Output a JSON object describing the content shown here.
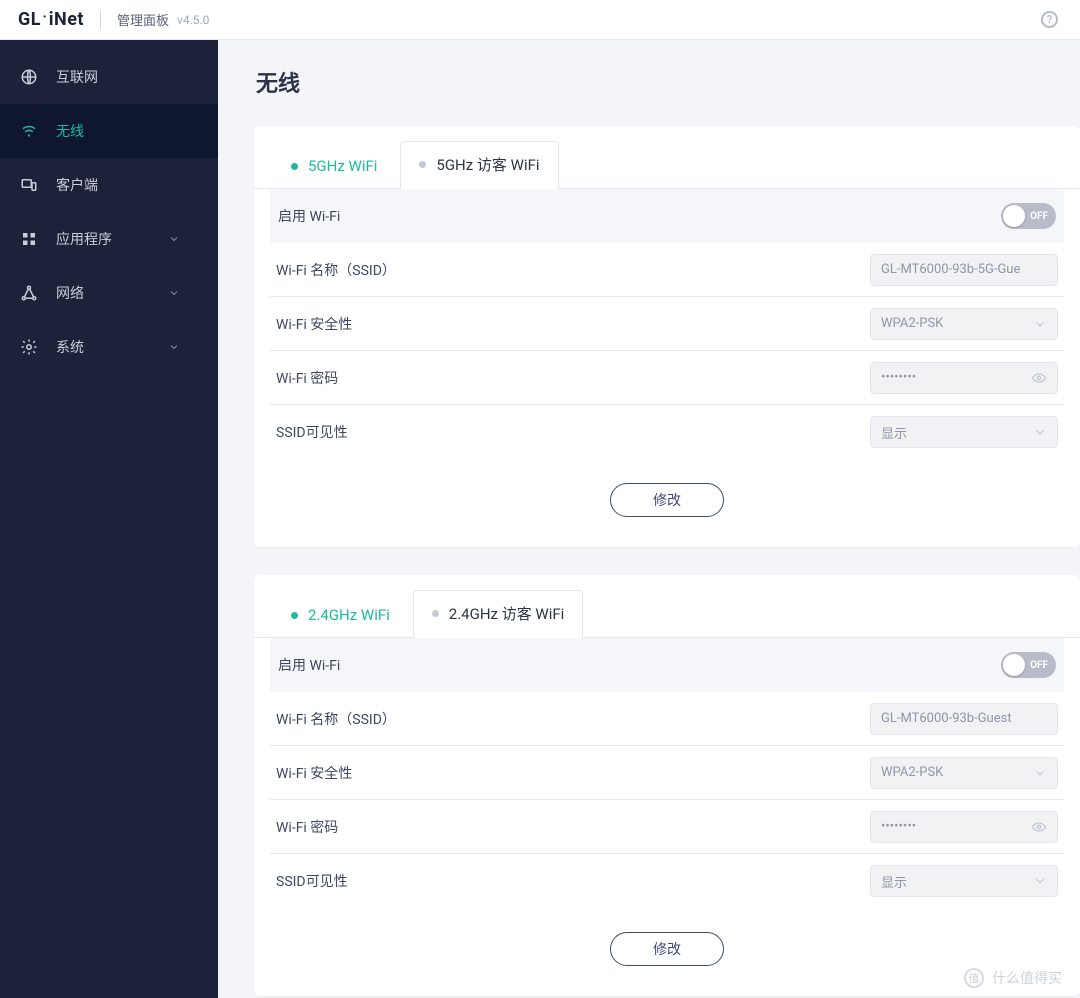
{
  "header": {
    "brand_a": "GL",
    "brand_b": "iNet",
    "panel_title": "管理面板",
    "version": "v4.5.0",
    "help_glyph": "?"
  },
  "sidebar": {
    "items": [
      {
        "id": "internet",
        "label": "互联网",
        "active": false,
        "expandable": false
      },
      {
        "id": "wireless",
        "label": "无线",
        "active": true,
        "expandable": false
      },
      {
        "id": "clients",
        "label": "客户端",
        "active": false,
        "expandable": false
      },
      {
        "id": "apps",
        "label": "应用程序",
        "active": false,
        "expandable": true
      },
      {
        "id": "network",
        "label": "网络",
        "active": false,
        "expandable": true
      },
      {
        "id": "system",
        "label": "系统",
        "active": false,
        "expandable": true
      }
    ]
  },
  "page": {
    "title": "无线"
  },
  "cards": [
    {
      "tabs": [
        {
          "label": "5GHz WiFi",
          "dot": "teal",
          "active": false
        },
        {
          "label": "5GHz 访客 WiFi",
          "dot": "grey",
          "active": true
        }
      ],
      "enable_label": "启用 Wi-Fi",
      "toggle_state": "OFF",
      "rows": [
        {
          "key": "ssid",
          "label": "Wi-Fi 名称（SSID）",
          "type": "text",
          "value": "GL-MT6000-93b-5G-Gue"
        },
        {
          "key": "security",
          "label": "Wi-Fi 安全性",
          "type": "select",
          "value": "WPA2-PSK"
        },
        {
          "key": "password",
          "label": "Wi-Fi 密码",
          "type": "password",
          "value": "••••••••"
        },
        {
          "key": "visibility",
          "label": "SSID可见性",
          "type": "select",
          "value": "显示"
        }
      ],
      "modify_label": "修改"
    },
    {
      "tabs": [
        {
          "label": "2.4GHz WiFi",
          "dot": "teal",
          "active": false
        },
        {
          "label": "2.4GHz 访客 WiFi",
          "dot": "grey",
          "active": true
        }
      ],
      "enable_label": "启用 Wi-Fi",
      "toggle_state": "OFF",
      "rows": [
        {
          "key": "ssid",
          "label": "Wi-Fi 名称（SSID）",
          "type": "text",
          "value": "GL-MT6000-93b-Guest"
        },
        {
          "key": "security",
          "label": "Wi-Fi 安全性",
          "type": "select",
          "value": "WPA2-PSK"
        },
        {
          "key": "password",
          "label": "Wi-Fi 密码",
          "type": "password",
          "value": "••••••••"
        },
        {
          "key": "visibility",
          "label": "SSID可见性",
          "type": "select",
          "value": "显示"
        }
      ],
      "modify_label": "修改"
    }
  ],
  "watermark": {
    "glyph": "值",
    "text": "什么值得买"
  }
}
